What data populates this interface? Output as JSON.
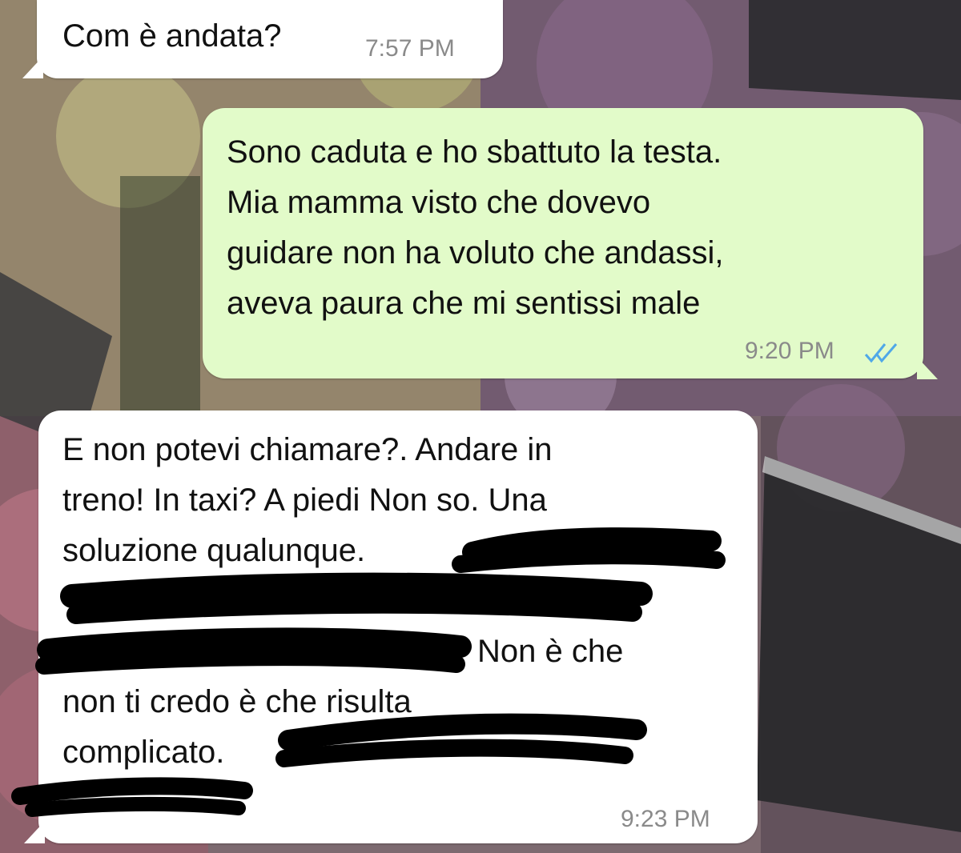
{
  "colors": {
    "incoming_bubble": "#ffffff",
    "outgoing_bubble": "#e2fbc9",
    "timestamp": "#8a8a8a",
    "read_receipt": "#4fa8e8"
  },
  "messages": [
    {
      "direction": "incoming",
      "text": "Com è andata?",
      "time": "7:57 PM"
    },
    {
      "direction": "outgoing",
      "text": "Sono caduta e ho sbattuto la testa.\nMia mamma visto che dovevo\nguidare non ha voluto che andassi,\naveva paura che mi sentissi male",
      "time": "9:20 PM",
      "status_icon": "double-check-read-icon"
    },
    {
      "direction": "incoming",
      "lines": [
        "E non potevi chiamare?. Andare in",
        "treno! In taxi? A piedi Non so. Una",
        "soluzione qualunque.",
        "",
        "",
        "Non è che",
        "non ti credo è che risulta",
        "complicato."
      ],
      "time": "9:23 PM",
      "redacted": true
    }
  ]
}
